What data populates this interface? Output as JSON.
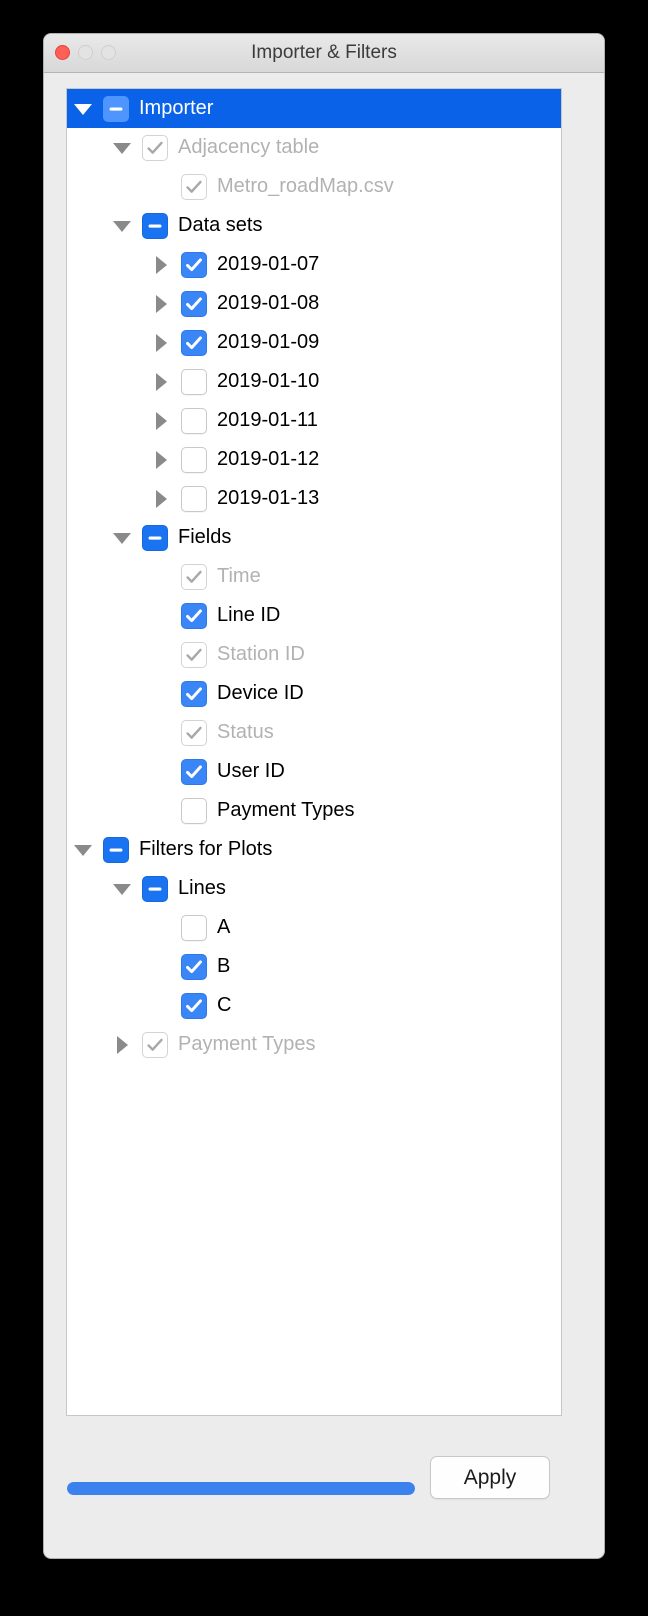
{
  "window": {
    "title": "Importer & Filters",
    "traffic_lights": [
      "close-button",
      "minimize-button",
      "maximize-button"
    ]
  },
  "colors": {
    "accent_blue": "#3b86f7",
    "selection_blue": "#0a62e8",
    "mixed_blue": "#1a73f0",
    "disabled_text": "#b2b2b2",
    "window_bg": "#ececec",
    "panel_bg": "#ffffff",
    "close_red": "#ff5f57"
  },
  "tree": {
    "rows": [
      {
        "label": "Importer",
        "depth": 0,
        "twisty": "open",
        "check": "mixed",
        "enabled": true,
        "selected": true
      },
      {
        "label": "Adjacency table",
        "depth": 1,
        "twisty": "open",
        "check": "disabled-on",
        "enabled": false,
        "selected": false
      },
      {
        "label": "Metro_roadMap.csv",
        "depth": 2,
        "twisty": "none",
        "check": "disabled-on",
        "enabled": false,
        "selected": false
      },
      {
        "label": "Data sets",
        "depth": 1,
        "twisty": "open",
        "check": "mixed",
        "enabled": true,
        "selected": false
      },
      {
        "label": "2019-01-07",
        "depth": 2,
        "twisty": "closed",
        "check": "on",
        "enabled": true,
        "selected": false
      },
      {
        "label": "2019-01-08",
        "depth": 2,
        "twisty": "closed",
        "check": "on",
        "enabled": true,
        "selected": false
      },
      {
        "label": "2019-01-09",
        "depth": 2,
        "twisty": "closed",
        "check": "on",
        "enabled": true,
        "selected": false
      },
      {
        "label": "2019-01-10",
        "depth": 2,
        "twisty": "closed",
        "check": "off",
        "enabled": true,
        "selected": false
      },
      {
        "label": "2019-01-11",
        "depth": 2,
        "twisty": "closed",
        "check": "off",
        "enabled": true,
        "selected": false
      },
      {
        "label": "2019-01-12",
        "depth": 2,
        "twisty": "closed",
        "check": "off",
        "enabled": true,
        "selected": false
      },
      {
        "label": "2019-01-13",
        "depth": 2,
        "twisty": "closed",
        "check": "off",
        "enabled": true,
        "selected": false
      },
      {
        "label": "Fields",
        "depth": 1,
        "twisty": "open",
        "check": "mixed",
        "enabled": true,
        "selected": false
      },
      {
        "label": "Time",
        "depth": 2,
        "twisty": "none",
        "check": "disabled-on",
        "enabled": false,
        "selected": false
      },
      {
        "label": "Line ID",
        "depth": 2,
        "twisty": "none",
        "check": "on",
        "enabled": true,
        "selected": false
      },
      {
        "label": "Station ID",
        "depth": 2,
        "twisty": "none",
        "check": "disabled-on",
        "enabled": false,
        "selected": false
      },
      {
        "label": "Device ID",
        "depth": 2,
        "twisty": "none",
        "check": "on",
        "enabled": true,
        "selected": false
      },
      {
        "label": "Status",
        "depth": 2,
        "twisty": "none",
        "check": "disabled-on",
        "enabled": false,
        "selected": false
      },
      {
        "label": "User ID",
        "depth": 2,
        "twisty": "none",
        "check": "on",
        "enabled": true,
        "selected": false
      },
      {
        "label": "Payment Types",
        "depth": 2,
        "twisty": "none",
        "check": "off",
        "enabled": true,
        "selected": false
      },
      {
        "label": "Filters for Plots",
        "depth": 0,
        "twisty": "open",
        "check": "mixed",
        "enabled": true,
        "selected": false
      },
      {
        "label": "Lines",
        "depth": 1,
        "twisty": "open",
        "check": "mixed",
        "enabled": true,
        "selected": false
      },
      {
        "label": "A",
        "depth": 2,
        "twisty": "none",
        "check": "off",
        "enabled": true,
        "selected": false
      },
      {
        "label": "B",
        "depth": 2,
        "twisty": "none",
        "check": "on",
        "enabled": true,
        "selected": false
      },
      {
        "label": "C",
        "depth": 2,
        "twisty": "none",
        "check": "on",
        "enabled": true,
        "selected": false
      },
      {
        "label": "Payment Types",
        "depth": 1,
        "twisty": "closed",
        "check": "disabled-on",
        "enabled": false,
        "selected": false
      }
    ]
  },
  "footer": {
    "progress_percent": 100,
    "apply_label": "Apply"
  }
}
